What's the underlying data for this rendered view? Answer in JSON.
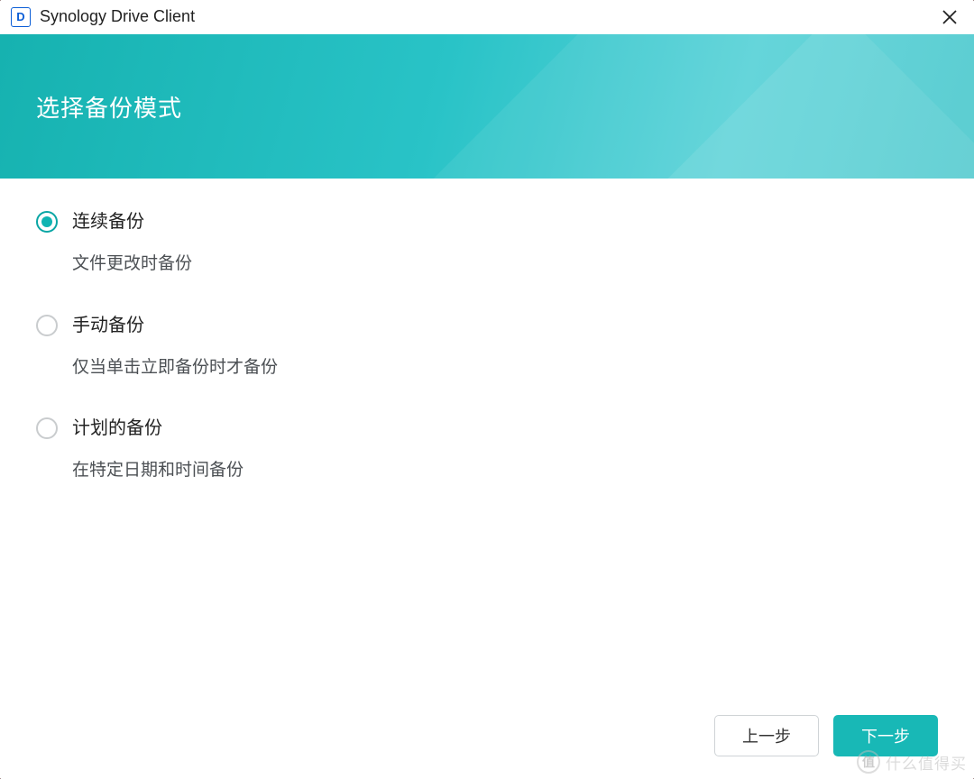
{
  "titlebar": {
    "app_icon_letter": "D",
    "title": "Synology Drive Client"
  },
  "banner": {
    "heading": "选择备份模式"
  },
  "options": [
    {
      "label": "连续备份",
      "desc": "文件更改时备份",
      "selected": true
    },
    {
      "label": "手动备份",
      "desc": "仅当单击立即备份时才备份",
      "selected": false
    },
    {
      "label": "计划的备份",
      "desc": "在特定日期和时间备份",
      "selected": false
    }
  ],
  "footer": {
    "back": "上一步",
    "next": "下一步"
  },
  "watermark": {
    "badge": "值",
    "text": "什么值得买"
  }
}
